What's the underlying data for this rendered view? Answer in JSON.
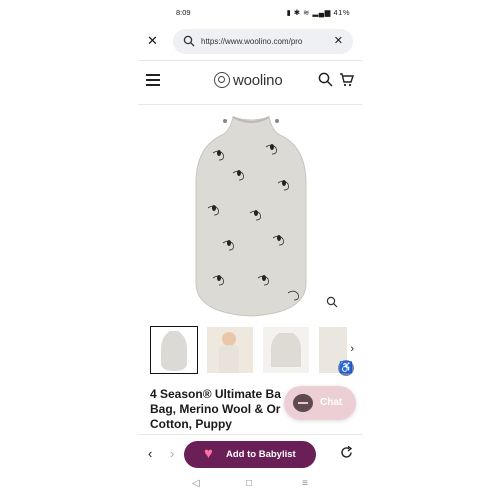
{
  "status_bar": {
    "time": "8:09",
    "battery": "41%"
  },
  "browser": {
    "url": "https://www.woolino.com/pro",
    "close_icon": "close-icon",
    "clear_icon": "clear-icon"
  },
  "site": {
    "brand": "woolino",
    "menu_icon": "hamburger-icon",
    "search_icon": "search-icon",
    "cart_icon": "cart-icon"
  },
  "product": {
    "title_line1": "4 Season® Ultimate Ba",
    "title_line2": "Bag, Merino Wool & Or",
    "title_line3": "Cotton, Puppy",
    "thumbnail_count": 4
  },
  "chat": {
    "label": "Chat"
  },
  "bottom_bar": {
    "add_button_label": "Add to Babylist"
  },
  "colors": {
    "accent_button": "#6b1f57",
    "chat_bg": "#e8c8ce",
    "accessibility": "#6f86a8"
  }
}
